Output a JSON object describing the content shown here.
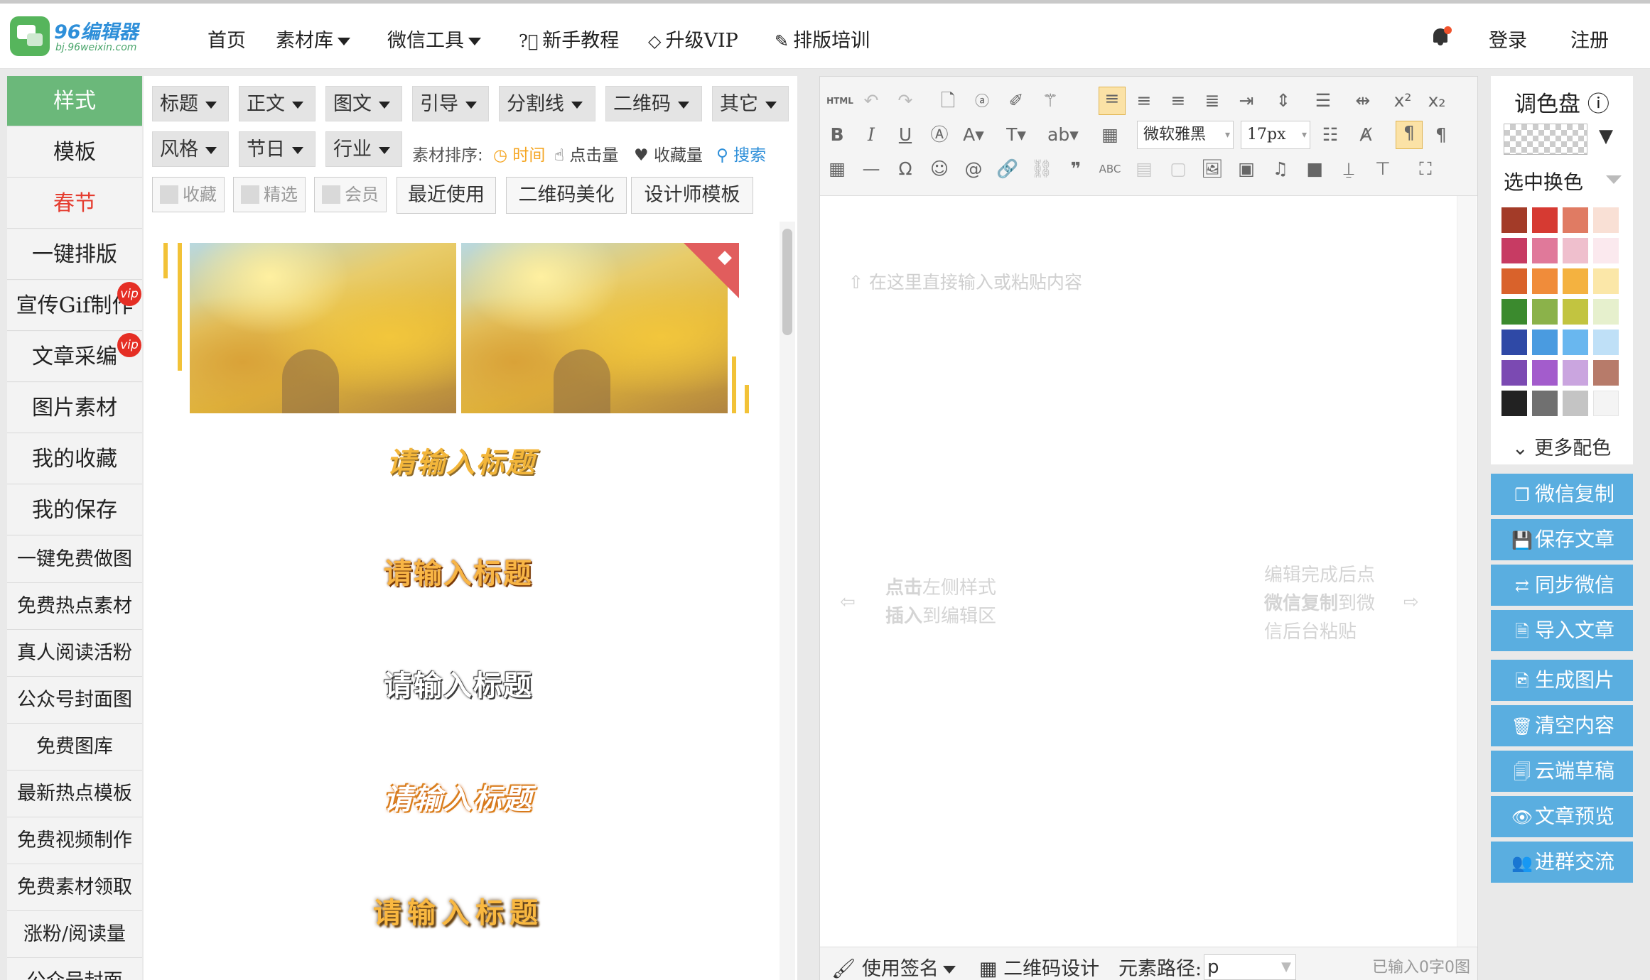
{
  "logo": {
    "title": "96编辑器",
    "url": "bj.96weixin.com"
  },
  "nav": {
    "home": "首页",
    "materials": "素材库",
    "wechat_tools": "微信工具",
    "tutorial": "新手教程",
    "upgrade_vip": "升级VIP",
    "training": "排版培训",
    "login": "登录",
    "register": "注册"
  },
  "sidebar": {
    "items": [
      "样式",
      "模板",
      "春节",
      "一键排版",
      "宣传Gif制作",
      "文章采编",
      "图片素材",
      "我的收藏",
      "我的保存",
      "一键免费做图",
      "免费热点素材",
      "真人阅读活粉",
      "公众号封面图",
      "免费图库",
      "最新热点模板",
      "免费视频制作",
      "免费素材领取",
      "涨粉/阅读量",
      "公众号封面"
    ],
    "vip_badge": "vip"
  },
  "style_panel": {
    "categories_row1": [
      "标题",
      "正文",
      "图文",
      "引导",
      "分割线",
      "二维码",
      "其它"
    ],
    "categories_row2": [
      "风格",
      "节日",
      "行业"
    ],
    "sort_label": "素材排序:",
    "sort_time": "时间",
    "sort_clicks": "点击量",
    "sort_favorites": "收藏量",
    "search": "搜索",
    "filters": [
      "收藏",
      "精选",
      "会员"
    ],
    "tabs": [
      "最近使用",
      "二维码美化",
      "设计师模板"
    ],
    "sample_titles": [
      "请输入标题",
      "请输入标题",
      "请输入标题",
      "请输入标题",
      "请输入标题"
    ],
    "accent_color": "#f2c237",
    "sort_time_color": "#f5a623",
    "search_color": "#2e8fd9"
  },
  "editor": {
    "html_label": "HTML",
    "font_family": "微软雅黑",
    "font_size": "17px",
    "placeholder": "在这里直接输入或粘贴内容",
    "left_tip_line1_bold": "点击",
    "left_tip_line1": "左侧样式",
    "left_tip_line2_bold": "插入",
    "left_tip_line2": "到编辑区",
    "right_tip_line1": "编辑完成后点",
    "right_tip_line2_bold": "微信复制",
    "right_tip_line2": "到微",
    "right_tip_line3": "信后台粘贴",
    "status_signature": "使用签名",
    "status_qrcode": "二维码设计",
    "status_path_label": "元素路径:",
    "status_path_value": "p",
    "word_count": "已输入0字0图"
  },
  "palette": {
    "title": "调色盘",
    "mode": "选中换色",
    "more": "更多配色",
    "swatches": [
      "#a33b28",
      "#d63a32",
      "#e07b63",
      "#f9e0d5",
      "#c73b63",
      "#e0799a",
      "#efbfcd",
      "#fbe9ee",
      "#d9622b",
      "#f08c3a",
      "#f4b240",
      "#fbe7a8",
      "#3b8a2e",
      "#8bb24a",
      "#c2c440",
      "#e6f0cd",
      "#2f49a6",
      "#4a9be0",
      "#69b7ef",
      "#bfe0f7",
      "#7b4ab2",
      "#a35ccc",
      "#caa5df",
      "#b77b6a",
      "#222222",
      "#707070",
      "#c4c4c4",
      "#f4f4f4"
    ]
  },
  "actions": [
    "微信复制",
    "保存文章",
    "同步微信",
    "导入文章",
    "生成图片",
    "清空内容",
    "云端草稿",
    "文章预览",
    "进群交流"
  ],
  "colors": {
    "green": "#6bb87a",
    "blue": "#5aaee0",
    "red": "#e53c2f"
  }
}
